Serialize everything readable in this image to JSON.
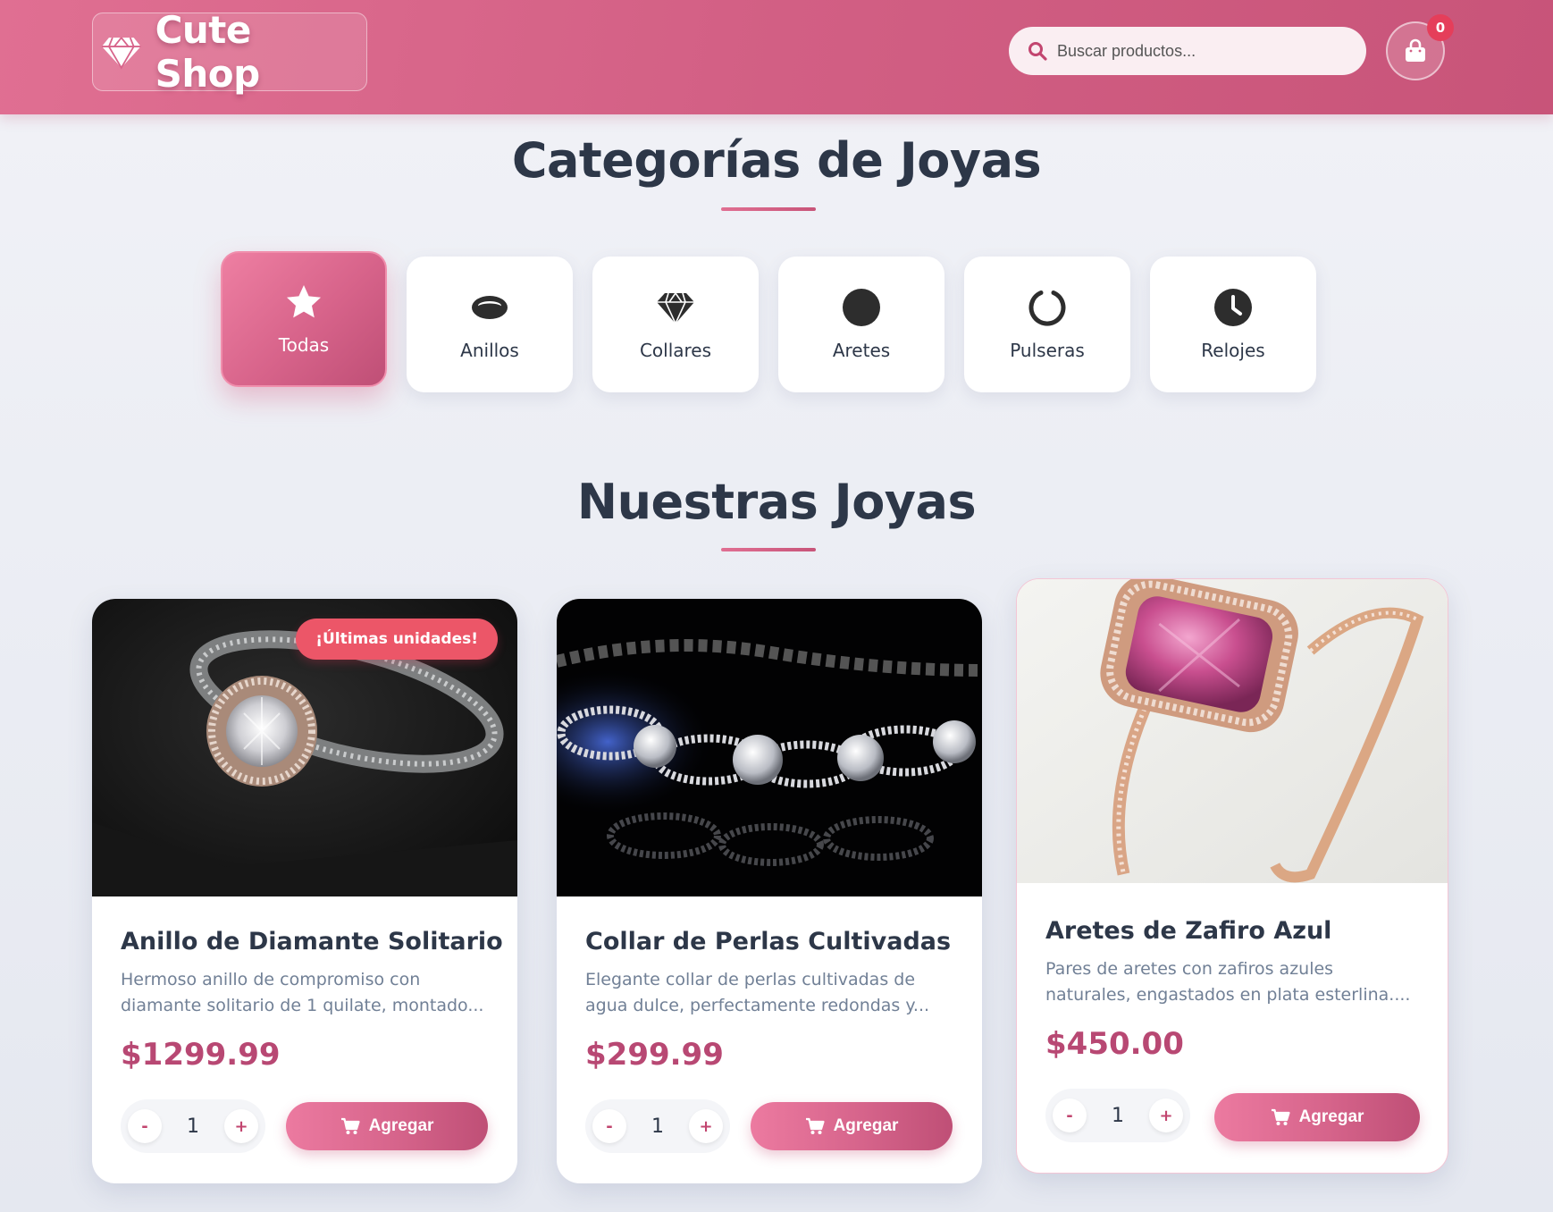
{
  "header": {
    "brand": "Cute Shop",
    "search_placeholder": "Buscar productos...",
    "cart_count": "0"
  },
  "categories_section": {
    "title": "Categorías de Joyas",
    "items": [
      {
        "label": "Todas",
        "icon": "star-icon",
        "active": true
      },
      {
        "label": "Anillos",
        "icon": "ring-icon",
        "active": false
      },
      {
        "label": "Collares",
        "icon": "gem-icon",
        "active": false
      },
      {
        "label": "Aretes",
        "icon": "circle-icon",
        "active": false
      },
      {
        "label": "Pulseras",
        "icon": "circle-notch-icon",
        "active": false
      },
      {
        "label": "Relojes",
        "icon": "clock-icon",
        "active": false
      }
    ]
  },
  "products_section": {
    "title": "Nuestras Joyas",
    "add_label": "Agregar",
    "products": [
      {
        "name": "Anillo de Diamante Solitario",
        "description": "Hermoso anillo de compromiso con diamante solitario de 1 quilate, montado...",
        "price": "$1299.99",
        "quantity": "1",
        "badge": "¡Últimas unidades!",
        "image": "diamond-halo-ring-photo"
      },
      {
        "name": "Collar de Perlas Cultivadas",
        "description": "Elegante collar de perlas cultivadas de agua dulce, perfectamente redondas y...",
        "price": "$299.99",
        "quantity": "1",
        "image": "diamond-bracelet-photo"
      },
      {
        "name": "Aretes de Zafiro Azul",
        "description": "Pares de aretes con zafiros azules naturales, engastados en plata esterlina....",
        "price": "$450.00",
        "quantity": "1",
        "image": "pink-gem-ring-photo"
      }
    ]
  },
  "colors": {
    "brand_pink": "#d25f84",
    "price": "#b84873",
    "badge": "#ec5668",
    "heading": "#2d3748"
  }
}
